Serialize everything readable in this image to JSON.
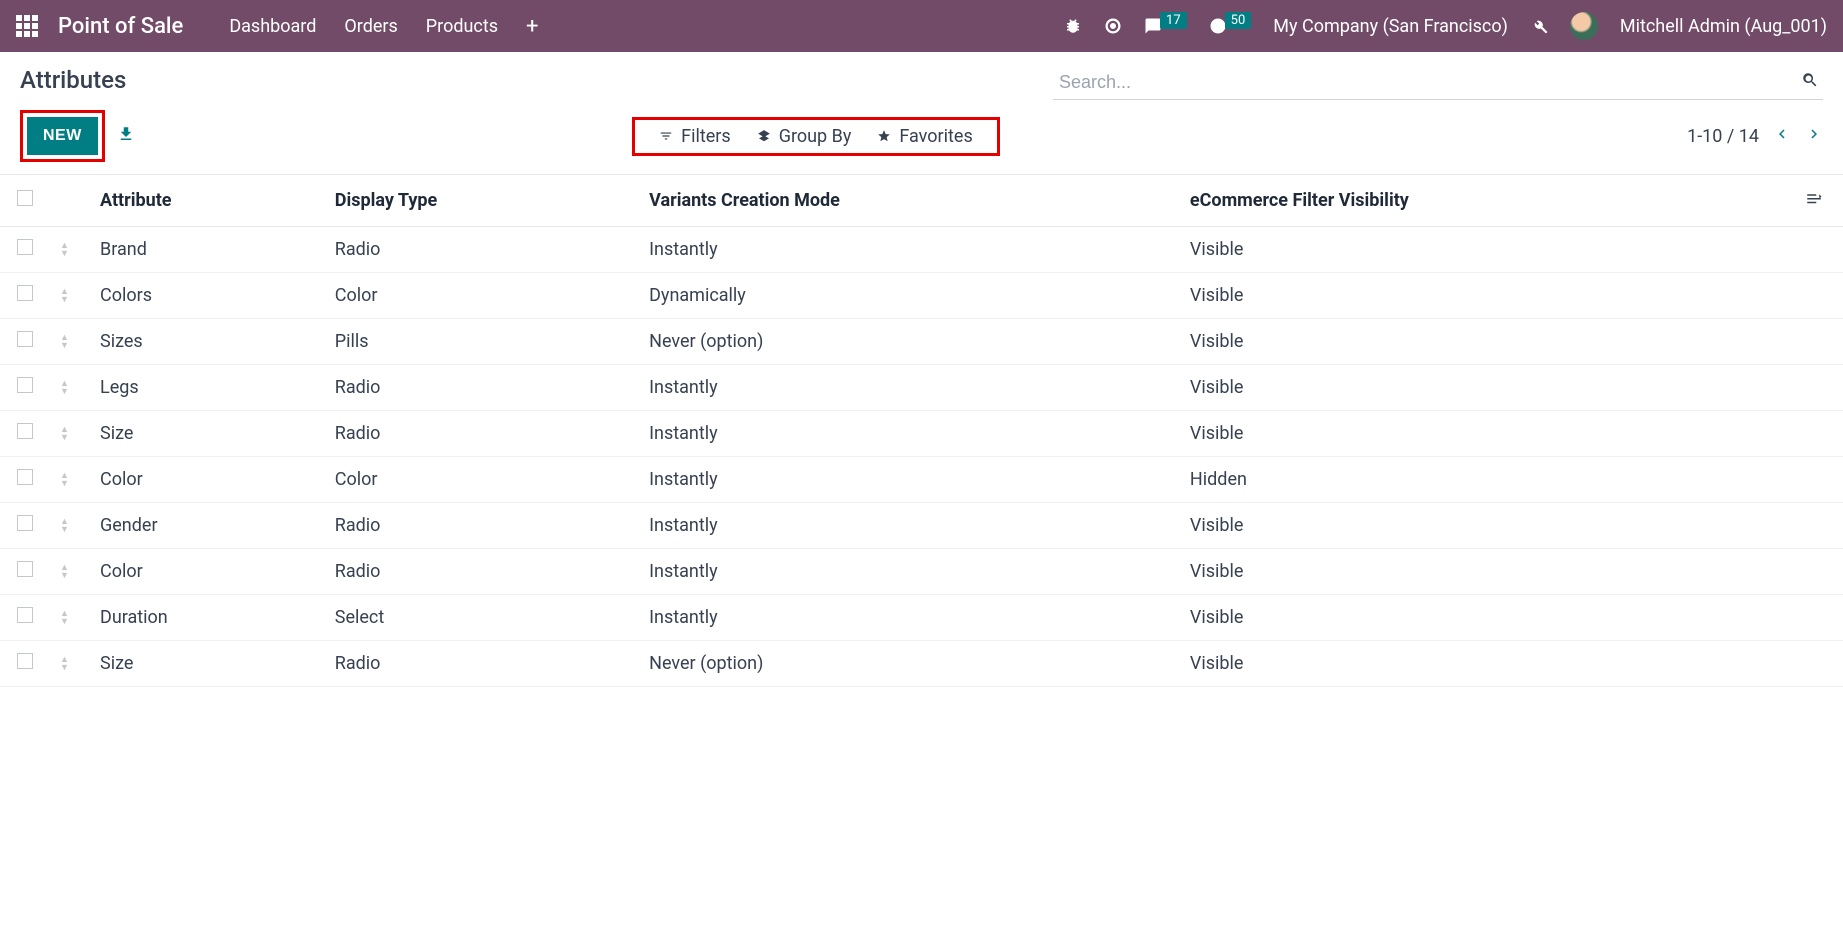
{
  "navbar": {
    "app_title": "Point of Sale",
    "menu": [
      "Dashboard",
      "Orders",
      "Products"
    ],
    "messaging_badge": "17",
    "activity_badge": "50",
    "company": "My Company (San Francisco)",
    "user": "Mitchell Admin (Aug_001)"
  },
  "control": {
    "breadcrumb": "Attributes",
    "new_label": "NEW",
    "search_placeholder": "Search...",
    "filters_label": "Filters",
    "groupby_label": "Group By",
    "favorites_label": "Favorites",
    "pager_text": "1-10 / 14"
  },
  "table": {
    "headers": {
      "attribute": "Attribute",
      "display_type": "Display Type",
      "variants_mode": "Variants Creation Mode",
      "ecommerce": "eCommerce Filter Visibility"
    },
    "rows": [
      {
        "attribute": "Brand",
        "display_type": "Radio",
        "variants_mode": "Instantly",
        "ecommerce": "Visible"
      },
      {
        "attribute": "Colors",
        "display_type": "Color",
        "variants_mode": "Dynamically",
        "ecommerce": "Visible"
      },
      {
        "attribute": "Sizes",
        "display_type": "Pills",
        "variants_mode": "Never (option)",
        "ecommerce": "Visible"
      },
      {
        "attribute": "Legs",
        "display_type": "Radio",
        "variants_mode": "Instantly",
        "ecommerce": "Visible"
      },
      {
        "attribute": "Size",
        "display_type": "Radio",
        "variants_mode": "Instantly",
        "ecommerce": "Visible"
      },
      {
        "attribute": "Color",
        "display_type": "Color",
        "variants_mode": "Instantly",
        "ecommerce": "Hidden"
      },
      {
        "attribute": "Gender",
        "display_type": "Radio",
        "variants_mode": "Instantly",
        "ecommerce": "Visible"
      },
      {
        "attribute": "Color",
        "display_type": "Radio",
        "variants_mode": "Instantly",
        "ecommerce": "Visible"
      },
      {
        "attribute": "Duration",
        "display_type": "Select",
        "variants_mode": "Instantly",
        "ecommerce": "Visible"
      },
      {
        "attribute": "Size",
        "display_type": "Radio",
        "variants_mode": "Never (option)",
        "ecommerce": "Visible"
      }
    ]
  }
}
